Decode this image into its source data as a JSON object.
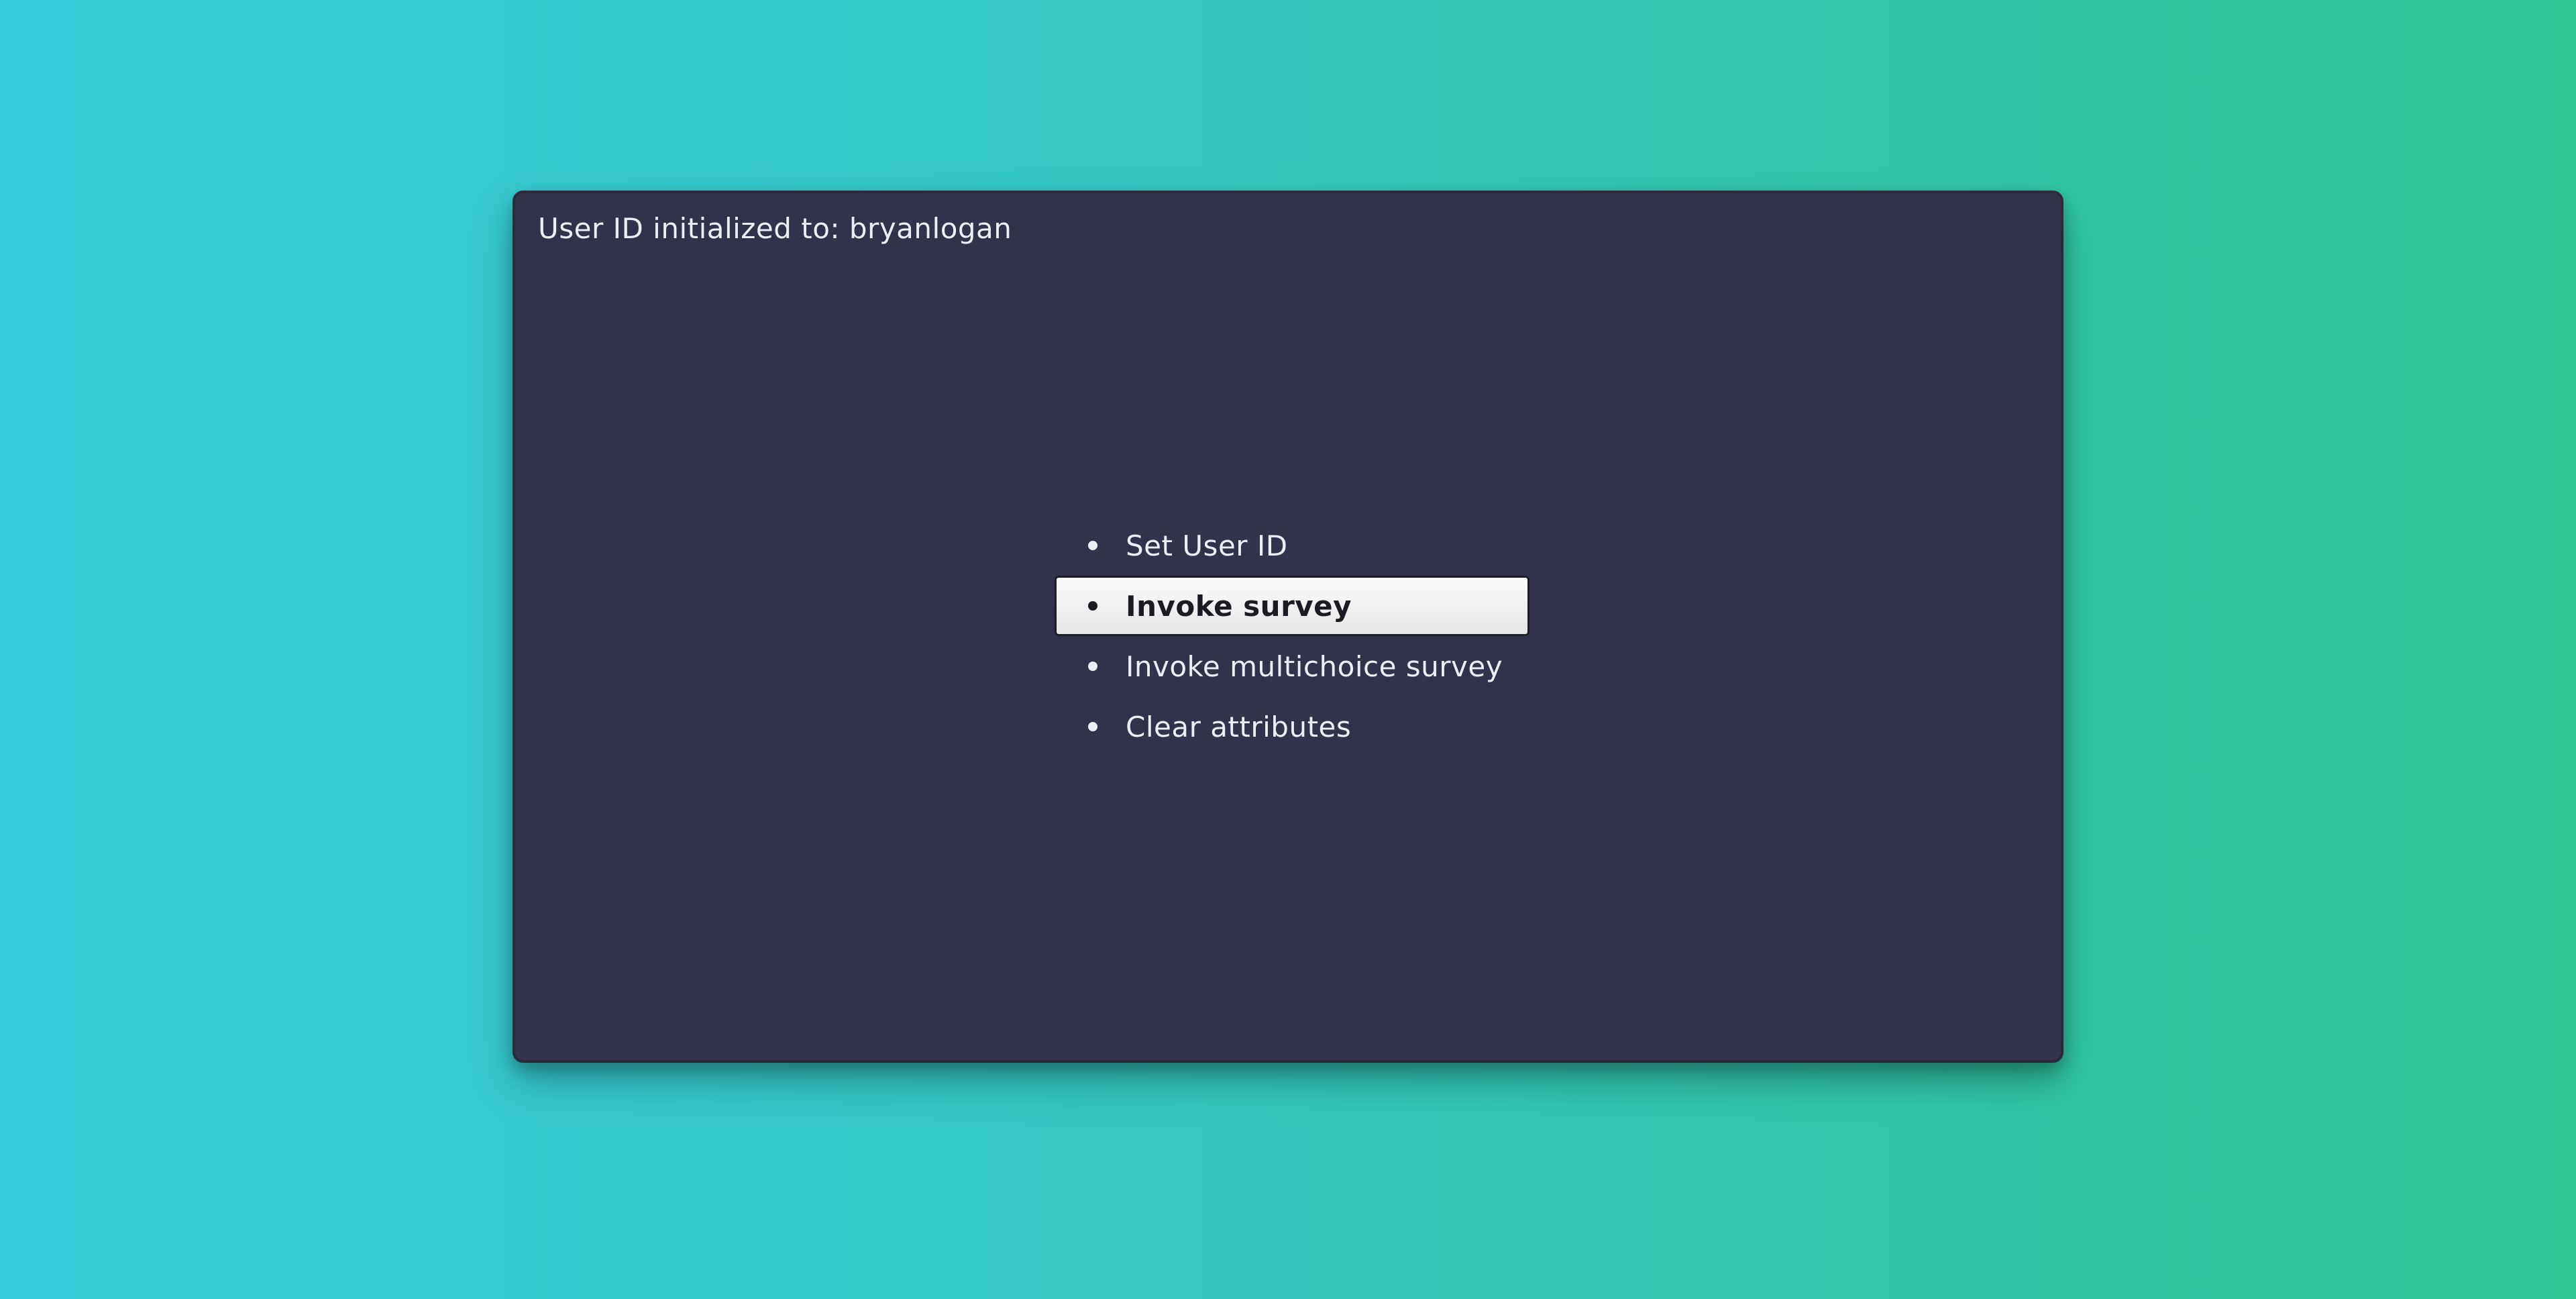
{
  "window": {
    "status_text": "User ID initialized to: bryanlogan"
  },
  "menu": {
    "selected_index": 1,
    "items": [
      {
        "label": "Set User ID"
      },
      {
        "label": "Invoke survey"
      },
      {
        "label": "Invoke multichoice survey"
      },
      {
        "label": "Clear attributes"
      }
    ]
  },
  "colors": {
    "background_start": "#39ccdb",
    "background_end": "#2fc494",
    "panel": "#33324b",
    "text": "#eceef3",
    "selected_bg": "#f2f2f2",
    "selected_text": "#1b1b24"
  }
}
